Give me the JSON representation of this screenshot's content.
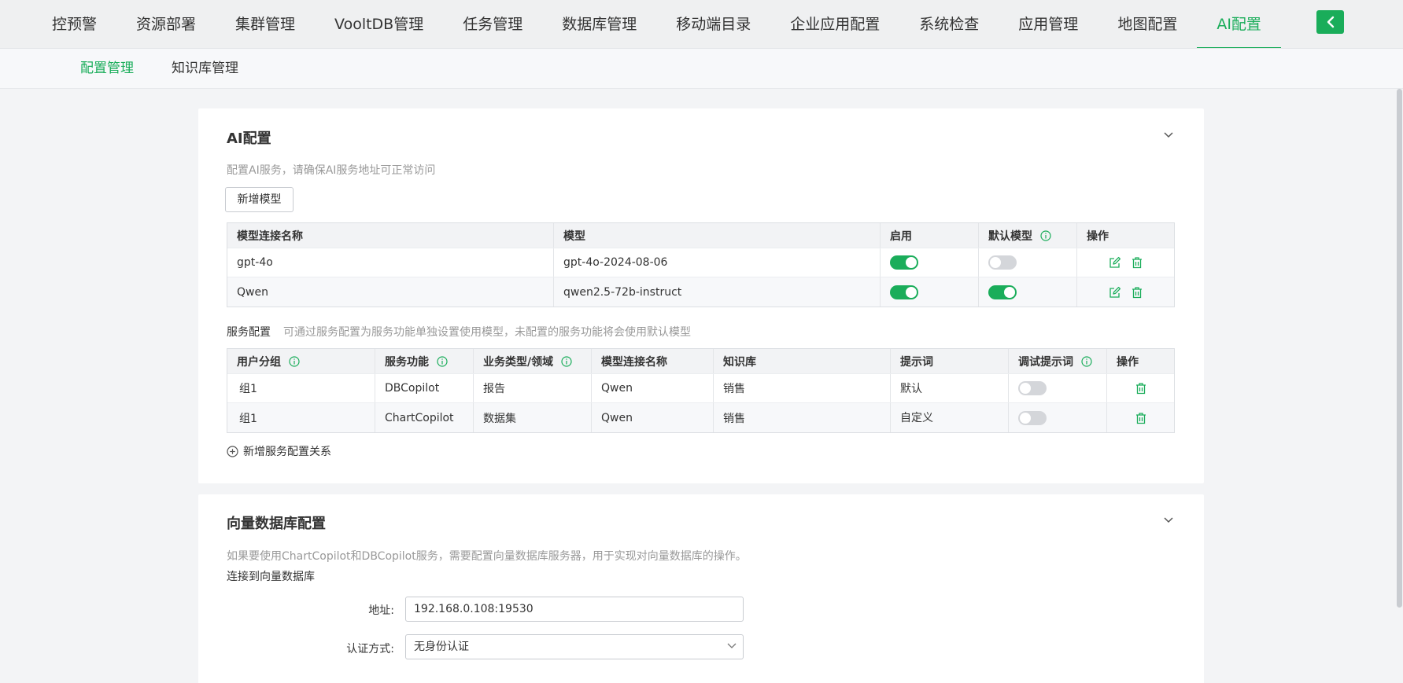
{
  "topnav": {
    "tabs": [
      "控预警",
      "资源部署",
      "集群管理",
      "VooltDB管理",
      "任务管理",
      "数据库管理",
      "移动端目录",
      "企业应用配置",
      "系统检查",
      "应用管理",
      "地图配置",
      "AI配置"
    ],
    "active": "AI配置",
    "collapse_icon": "chevron-left-icon"
  },
  "subnav": {
    "tabs": [
      "配置管理",
      "知识库管理"
    ],
    "active": "配置管理"
  },
  "ai_config": {
    "title": "AI配置",
    "description": "配置AI服务，请确保AI服务地址可正常访问",
    "add_model_label": "新增模型",
    "models_table": {
      "headers": [
        "模型连接名称",
        "模型",
        "启用",
        "默认模型",
        "操作"
      ],
      "rows": [
        {
          "name": "gpt-4o",
          "model": "gpt-4o-2024-08-06",
          "enabled": true,
          "default": false
        },
        {
          "name": "Qwen",
          "model": "qwen2.5-72b-instruct",
          "enabled": true,
          "default": true
        }
      ]
    },
    "service_title": "服务配置",
    "service_hint": "可通过服务配置为服务功能单独设置使用模型，未配置的服务功能将会使用默认模型",
    "service_table": {
      "headers": [
        "用户分组",
        "服务功能",
        "业务类型/领域",
        "模型连接名称",
        "知识库",
        "提示词",
        "调试提示词",
        "操作"
      ],
      "rows": [
        {
          "group": "组1",
          "feature": "DBCopilot",
          "domain": "报告",
          "model_name": "Qwen",
          "kb": "销售",
          "prompt": "默认",
          "debug": false
        },
        {
          "group": "组1",
          "feature": "ChartCopilot",
          "domain": "数据集",
          "model_name": "Qwen",
          "kb": "销售",
          "prompt": "自定义",
          "debug": false
        }
      ]
    },
    "add_service_label": "新增服务配置关系"
  },
  "vector_db": {
    "title": "向量数据库配置",
    "description": "如果要使用ChartCopilot和DBCopilot服务，需要配置向量数据库服务器，用于实现对向量数据库的操作。",
    "connect_label": "连接到向量数据库",
    "address_label": "地址:",
    "address_value": "192.168.0.108:19530",
    "auth_label": "认证方式:",
    "auth_value": "无身份认证"
  },
  "colors": {
    "accent": "#1aad5a"
  }
}
